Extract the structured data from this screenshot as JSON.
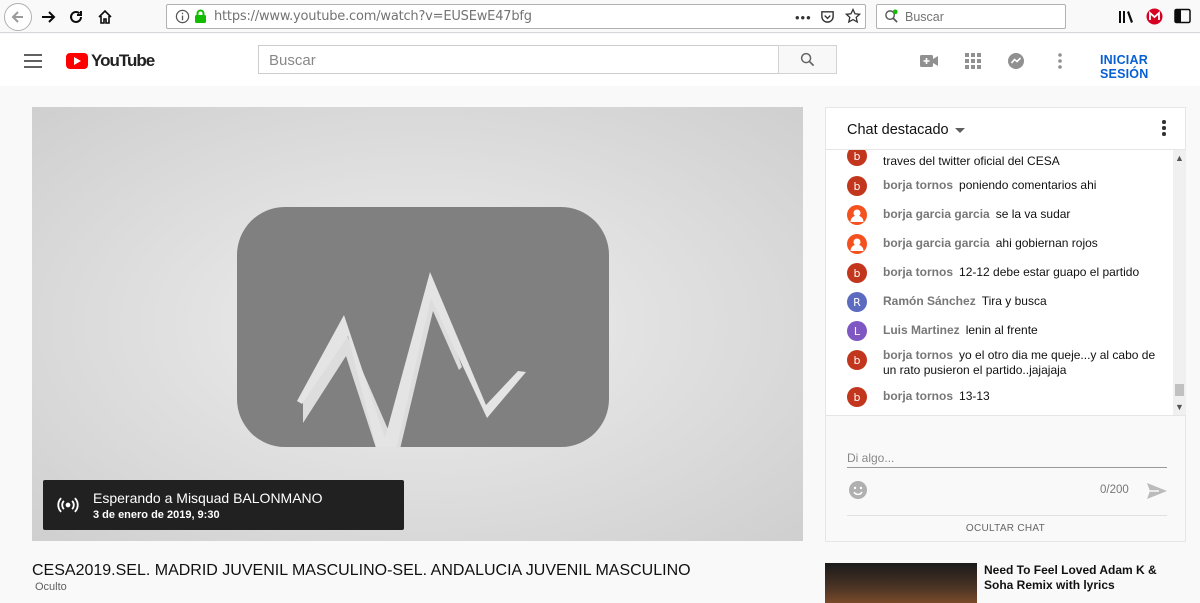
{
  "browser": {
    "url": "https://www.youtube.com/watch?v=EUSEwE47bfg",
    "search_placeholder": "Buscar",
    "icons": [
      "back-icon",
      "forward-icon",
      "reload-icon",
      "home-icon",
      "info-icon",
      "lock-icon",
      "page-actions-icon",
      "pocket-icon",
      "bookmark-star-icon",
      "library-icon",
      "extension-icon",
      "sidebar-icon"
    ]
  },
  "header": {
    "logo_text": "YouTube",
    "search_placeholder": "Buscar",
    "signin_label": "INICIAR SESIÓN",
    "icons": [
      "menu-icon",
      "search-icon",
      "create-video-icon",
      "apps-grid-icon",
      "messages-icon",
      "more-vert-icon"
    ]
  },
  "player": {
    "waiting_title": "Esperando a Misquad BALONMANO",
    "waiting_date": "3 de enero de 2019, 9:30"
  },
  "video": {
    "title": "CESA2019.SEL. MADRID JUVENIL MASCULINO-SEL. ANDALUCIA JUVENIL MASCULINO",
    "visibility": "Oculto"
  },
  "chat": {
    "title": "Chat destacado",
    "messages": [
      {
        "avatar": "b",
        "color": "#c1361c",
        "author": "",
        "text": "traves del twitter oficial del CESA"
      },
      {
        "avatar": "b",
        "color": "#c1361c",
        "author": "borja tornos",
        "text": "poniendo comentarios ahi"
      },
      {
        "avatar": "",
        "color": "#f4511e",
        "author": "borja garcia garcia",
        "text": "se la va sudar"
      },
      {
        "avatar": "",
        "color": "#f4511e",
        "author": "borja garcia garcia",
        "text": "ahi gobiernan rojos"
      },
      {
        "avatar": "b",
        "color": "#c1361c",
        "author": "borja tornos",
        "text": "12-12 debe estar guapo el partido"
      },
      {
        "avatar": "R",
        "color": "#5c6bc0",
        "author": "Ramón Sánchez",
        "text": "Tira y busca"
      },
      {
        "avatar": "L",
        "color": "#7e57c2",
        "author": "Luis Martinez",
        "text": "lenin al frente"
      },
      {
        "avatar": "b",
        "color": "#c1361c",
        "author": "borja tornos",
        "text": "yo el otro dia me queje...y al cabo de un rato pusieron el partido..jajajaja"
      },
      {
        "avatar": "b",
        "color": "#c1361c",
        "author": "borja tornos",
        "text": "13-13"
      }
    ],
    "input_placeholder": "Di algo...",
    "counter": "0/200",
    "hide_chat": "OCULTAR CHAT"
  },
  "suggestion": {
    "title": "Need To Feel Loved Adam K & Soha Remix with lyrics"
  }
}
